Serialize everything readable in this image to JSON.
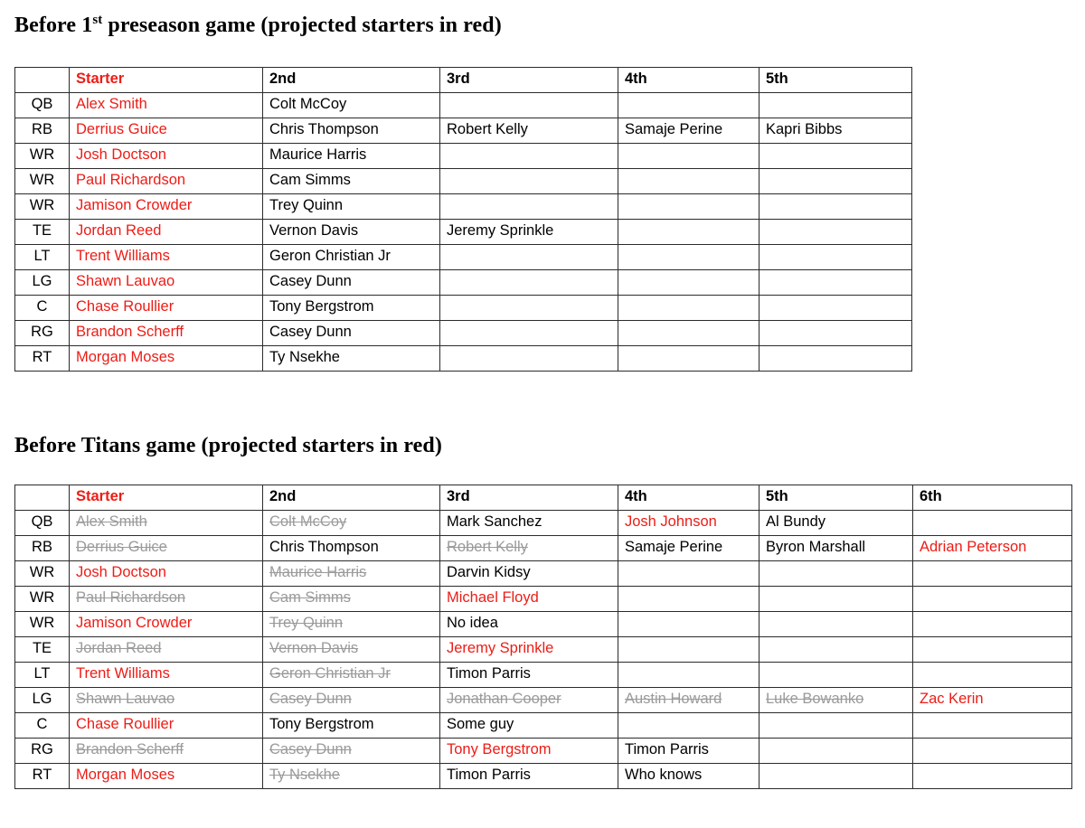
{
  "document": {
    "accent_red": "#ED1C16",
    "struck_gray": "#9a9a9a",
    "border_color": "#2b2b2b"
  },
  "section1": {
    "title_prefix": "Before 1",
    "title_sup": "st",
    "title_suffix": " preseason game (projected starters in red)",
    "table": {
      "headers": [
        "",
        "Starter",
        "2nd",
        "3rd",
        "4th",
        "5th"
      ],
      "rows": [
        {
          "pos": "QB",
          "cells": [
            {
              "text": "Alex Smith",
              "style": "red"
            },
            {
              "text": "Colt McCoy",
              "style": "black"
            },
            {
              "text": "",
              "style": "black"
            },
            {
              "text": "",
              "style": "black"
            },
            {
              "text": "",
              "style": "black"
            }
          ]
        },
        {
          "pos": "RB",
          "cells": [
            {
              "text": "Derrius Guice",
              "style": "red"
            },
            {
              "text": "Chris Thompson",
              "style": "black"
            },
            {
              "text": "Robert Kelly",
              "style": "black"
            },
            {
              "text": "Samaje Perine",
              "style": "black"
            },
            {
              "text": "Kapri Bibbs",
              "style": "black"
            }
          ]
        },
        {
          "pos": "WR",
          "cells": [
            {
              "text": "Josh Doctson",
              "style": "red"
            },
            {
              "text": "Maurice Harris",
              "style": "black"
            },
            {
              "text": "",
              "style": "black"
            },
            {
              "text": "",
              "style": "black"
            },
            {
              "text": "",
              "style": "black"
            }
          ]
        },
        {
          "pos": "WR",
          "cells": [
            {
              "text": "Paul Richardson",
              "style": "red"
            },
            {
              "text": "Cam Simms",
              "style": "black"
            },
            {
              "text": "",
              "style": "black"
            },
            {
              "text": "",
              "style": "black"
            },
            {
              "text": "",
              "style": "black"
            }
          ]
        },
        {
          "pos": "WR",
          "cells": [
            {
              "text": "Jamison Crowder",
              "style": "red"
            },
            {
              "text": "Trey Quinn",
              "style": "black"
            },
            {
              "text": "",
              "style": "black"
            },
            {
              "text": "",
              "style": "black"
            },
            {
              "text": "",
              "style": "black"
            }
          ]
        },
        {
          "pos": "TE",
          "cells": [
            {
              "text": "Jordan Reed",
              "style": "red"
            },
            {
              "text": "Vernon Davis",
              "style": "black"
            },
            {
              "text": "Jeremy Sprinkle",
              "style": "black"
            },
            {
              "text": "",
              "style": "black"
            },
            {
              "text": "",
              "style": "black"
            }
          ]
        },
        {
          "pos": "LT",
          "cells": [
            {
              "text": "Trent Williams",
              "style": "red"
            },
            {
              "text": "Geron Christian Jr",
              "style": "black"
            },
            {
              "text": "",
              "style": "black"
            },
            {
              "text": "",
              "style": "black"
            },
            {
              "text": "",
              "style": "black"
            }
          ]
        },
        {
          "pos": "LG",
          "cells": [
            {
              "text": "Shawn Lauvao",
              "style": "red"
            },
            {
              "text": "Casey Dunn",
              "style": "black"
            },
            {
              "text": "",
              "style": "black"
            },
            {
              "text": "",
              "style": "black"
            },
            {
              "text": "",
              "style": "black"
            }
          ]
        },
        {
          "pos": "C",
          "cells": [
            {
              "text": "Chase Roullier",
              "style": "red"
            },
            {
              "text": "Tony Bergstrom",
              "style": "black"
            },
            {
              "text": "",
              "style": "black"
            },
            {
              "text": "",
              "style": "black"
            },
            {
              "text": "",
              "style": "black"
            }
          ]
        },
        {
          "pos": "RG",
          "cells": [
            {
              "text": "Brandon Scherff",
              "style": "red"
            },
            {
              "text": "Casey Dunn",
              "style": "black"
            },
            {
              "text": "",
              "style": "black"
            },
            {
              "text": "",
              "style": "black"
            },
            {
              "text": "",
              "style": "black"
            }
          ]
        },
        {
          "pos": "RT",
          "cells": [
            {
              "text": "Morgan Moses",
              "style": "red"
            },
            {
              "text": "Ty Nsekhe",
              "style": "black"
            },
            {
              "text": "",
              "style": "black"
            },
            {
              "text": "",
              "style": "black"
            },
            {
              "text": "",
              "style": "black"
            }
          ]
        }
      ]
    }
  },
  "section2": {
    "title": "Before Titans game (projected starters in red)",
    "table": {
      "headers": [
        "",
        "Starter",
        "2nd",
        "3rd",
        "4th",
        "5th",
        "6th"
      ],
      "rows": [
        {
          "pos": "QB",
          "cells": [
            {
              "text": "Alex Smith",
              "style": "struck"
            },
            {
              "text": "Colt McCoy",
              "style": "struck"
            },
            {
              "text": "Mark Sanchez",
              "style": "black"
            },
            {
              "text": "Josh Johnson",
              "style": "red"
            },
            {
              "text": "Al Bundy",
              "style": "black"
            },
            {
              "text": "",
              "style": "black"
            }
          ]
        },
        {
          "pos": "RB",
          "cells": [
            {
              "text": "Derrius Guice",
              "style": "struck"
            },
            {
              "text": "Chris Thompson",
              "style": "black"
            },
            {
              "text": "Robert Kelly",
              "style": "struck"
            },
            {
              "text": "Samaje Perine",
              "style": "black"
            },
            {
              "text": "Byron Marshall",
              "style": "black"
            },
            {
              "text": "Adrian Peterson",
              "style": "red"
            }
          ]
        },
        {
          "pos": "WR",
          "cells": [
            {
              "text": "Josh Doctson",
              "style": "red"
            },
            {
              "text": "Maurice Harris",
              "style": "struck"
            },
            {
              "text": "Darvin Kidsy",
              "style": "black"
            },
            {
              "text": "",
              "style": "black"
            },
            {
              "text": "",
              "style": "black"
            },
            {
              "text": "",
              "style": "black"
            }
          ]
        },
        {
          "pos": "WR",
          "cells": [
            {
              "text": "Paul Richardson",
              "style": "struck"
            },
            {
              "text": "Cam Simms",
              "style": "struck"
            },
            {
              "text": "Michael Floyd",
              "style": "red"
            },
            {
              "text": "",
              "style": "black"
            },
            {
              "text": "",
              "style": "black"
            },
            {
              "text": "",
              "style": "black"
            }
          ]
        },
        {
          "pos": "WR",
          "cells": [
            {
              "text": "Jamison Crowder",
              "style": "red"
            },
            {
              "text": "Trey Quinn",
              "style": "struck"
            },
            {
              "text": "No idea",
              "style": "black"
            },
            {
              "text": "",
              "style": "black"
            },
            {
              "text": "",
              "style": "black"
            },
            {
              "text": "",
              "style": "black"
            }
          ]
        },
        {
          "pos": "TE",
          "cells": [
            {
              "text": "Jordan Reed",
              "style": "struck"
            },
            {
              "text": "Vernon Davis",
              "style": "struck"
            },
            {
              "text": "Jeremy Sprinkle",
              "style": "red"
            },
            {
              "text": "",
              "style": "black"
            },
            {
              "text": "",
              "style": "black"
            },
            {
              "text": "",
              "style": "black"
            }
          ]
        },
        {
          "pos": "LT",
          "cells": [
            {
              "text": "Trent Williams",
              "style": "red"
            },
            {
              "text": "Geron Christian Jr",
              "style": "struck"
            },
            {
              "text": "Timon Parris",
              "style": "black"
            },
            {
              "text": "",
              "style": "black"
            },
            {
              "text": "",
              "style": "black"
            },
            {
              "text": "",
              "style": "black"
            }
          ]
        },
        {
          "pos": "LG",
          "cells": [
            {
              "text": "Shawn Lauvao",
              "style": "struck"
            },
            {
              "text": "Casey Dunn",
              "style": "struck"
            },
            {
              "text": "Jonathan Cooper",
              "style": "struck"
            },
            {
              "text": "Austin Howard",
              "style": "struck"
            },
            {
              "text": "Luke Bowanko",
              "style": "struck"
            },
            {
              "text": "Zac Kerin",
              "style": "red"
            }
          ]
        },
        {
          "pos": "C",
          "cells": [
            {
              "text": "Chase Roullier",
              "style": "red"
            },
            {
              "text": "Tony Bergstrom",
              "style": "black"
            },
            {
              "text": "Some guy",
              "style": "black"
            },
            {
              "text": "",
              "style": "black"
            },
            {
              "text": "",
              "style": "black"
            },
            {
              "text": "",
              "style": "black"
            }
          ]
        },
        {
          "pos": "RG",
          "cells": [
            {
              "text": "Brandon Scherff",
              "style": "struck"
            },
            {
              "text": "Casey Dunn",
              "style": "struck"
            },
            {
              "text": "Tony Bergstrom",
              "style": "red"
            },
            {
              "text": "Timon Parris",
              "style": "black"
            },
            {
              "text": "",
              "style": "black"
            },
            {
              "text": "",
              "style": "black"
            }
          ]
        },
        {
          "pos": "RT",
          "cells": [
            {
              "text": "Morgan Moses",
              "style": "red"
            },
            {
              "text": "Ty Nsekhe",
              "style": "struck"
            },
            {
              "text": "Timon Parris",
              "style": "black"
            },
            {
              "text": "Who knows",
              "style": "black"
            },
            {
              "text": "",
              "style": "black"
            },
            {
              "text": "",
              "style": "black"
            }
          ]
        }
      ]
    }
  }
}
